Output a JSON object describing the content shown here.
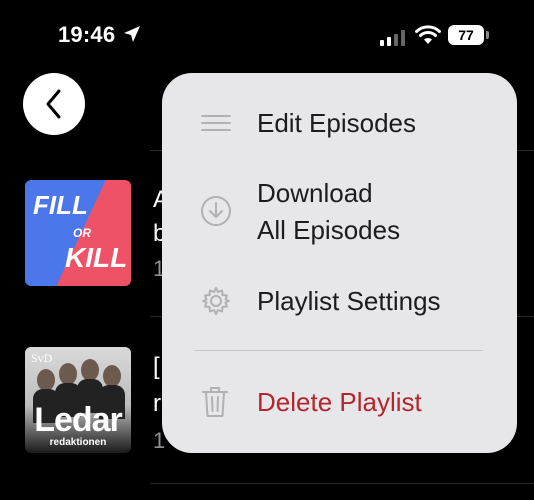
{
  "status_bar": {
    "time": "19:46",
    "battery": "77",
    "icons": [
      "location-arrow-icon",
      "cellular-signal-icon",
      "wifi-icon",
      "battery-icon"
    ]
  },
  "nav": {
    "back_icon": "chevron-left-icon"
  },
  "episodes": [
    {
      "title_partial": "A",
      "title_line2_partial": "b",
      "meta_partial": "1",
      "artwork_text": [
        "FILL",
        "OR",
        "KILL"
      ]
    },
    {
      "title_partial": "[",
      "title_line2_partial": "r",
      "meta_partial": "1",
      "artwork_text": [
        "SvD",
        "Ledar",
        "redaktionen"
      ]
    }
  ],
  "menu": {
    "items": [
      {
        "label": "Edit Episodes",
        "icon": "list-lines-icon"
      },
      {
        "label_line1": "Download",
        "label_line2": "All Episodes",
        "icon": "download-circle-icon"
      },
      {
        "label": "Playlist Settings",
        "icon": "gear-icon"
      },
      {
        "label": "Delete Playlist",
        "icon": "trash-icon",
        "color": "#b3262e"
      }
    ]
  },
  "colors": {
    "background": "#000000",
    "menu_background": "#e7e7ea",
    "destructive": "#b3262e",
    "icon_gray": "#a0a0a5"
  }
}
